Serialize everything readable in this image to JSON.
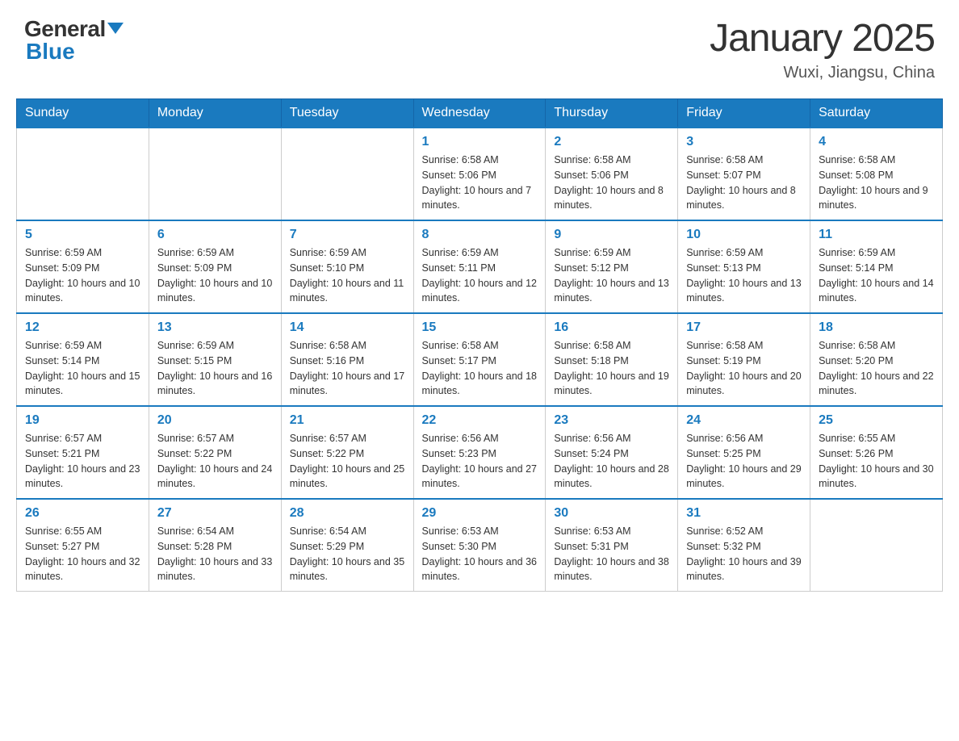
{
  "header": {
    "logo_general": "General",
    "logo_blue": "Blue",
    "month_title": "January 2025",
    "location": "Wuxi, Jiangsu, China"
  },
  "days_of_week": [
    "Sunday",
    "Monday",
    "Tuesday",
    "Wednesday",
    "Thursday",
    "Friday",
    "Saturday"
  ],
  "weeks": [
    [
      {
        "day": "",
        "info": ""
      },
      {
        "day": "",
        "info": ""
      },
      {
        "day": "",
        "info": ""
      },
      {
        "day": "1",
        "info": "Sunrise: 6:58 AM\nSunset: 5:06 PM\nDaylight: 10 hours and 7 minutes."
      },
      {
        "day": "2",
        "info": "Sunrise: 6:58 AM\nSunset: 5:06 PM\nDaylight: 10 hours and 8 minutes."
      },
      {
        "day": "3",
        "info": "Sunrise: 6:58 AM\nSunset: 5:07 PM\nDaylight: 10 hours and 8 minutes."
      },
      {
        "day": "4",
        "info": "Sunrise: 6:58 AM\nSunset: 5:08 PM\nDaylight: 10 hours and 9 minutes."
      }
    ],
    [
      {
        "day": "5",
        "info": "Sunrise: 6:59 AM\nSunset: 5:09 PM\nDaylight: 10 hours and 10 minutes."
      },
      {
        "day": "6",
        "info": "Sunrise: 6:59 AM\nSunset: 5:09 PM\nDaylight: 10 hours and 10 minutes."
      },
      {
        "day": "7",
        "info": "Sunrise: 6:59 AM\nSunset: 5:10 PM\nDaylight: 10 hours and 11 minutes."
      },
      {
        "day": "8",
        "info": "Sunrise: 6:59 AM\nSunset: 5:11 PM\nDaylight: 10 hours and 12 minutes."
      },
      {
        "day": "9",
        "info": "Sunrise: 6:59 AM\nSunset: 5:12 PM\nDaylight: 10 hours and 13 minutes."
      },
      {
        "day": "10",
        "info": "Sunrise: 6:59 AM\nSunset: 5:13 PM\nDaylight: 10 hours and 13 minutes."
      },
      {
        "day": "11",
        "info": "Sunrise: 6:59 AM\nSunset: 5:14 PM\nDaylight: 10 hours and 14 minutes."
      }
    ],
    [
      {
        "day": "12",
        "info": "Sunrise: 6:59 AM\nSunset: 5:14 PM\nDaylight: 10 hours and 15 minutes."
      },
      {
        "day": "13",
        "info": "Sunrise: 6:59 AM\nSunset: 5:15 PM\nDaylight: 10 hours and 16 minutes."
      },
      {
        "day": "14",
        "info": "Sunrise: 6:58 AM\nSunset: 5:16 PM\nDaylight: 10 hours and 17 minutes."
      },
      {
        "day": "15",
        "info": "Sunrise: 6:58 AM\nSunset: 5:17 PM\nDaylight: 10 hours and 18 minutes."
      },
      {
        "day": "16",
        "info": "Sunrise: 6:58 AM\nSunset: 5:18 PM\nDaylight: 10 hours and 19 minutes."
      },
      {
        "day": "17",
        "info": "Sunrise: 6:58 AM\nSunset: 5:19 PM\nDaylight: 10 hours and 20 minutes."
      },
      {
        "day": "18",
        "info": "Sunrise: 6:58 AM\nSunset: 5:20 PM\nDaylight: 10 hours and 22 minutes."
      }
    ],
    [
      {
        "day": "19",
        "info": "Sunrise: 6:57 AM\nSunset: 5:21 PM\nDaylight: 10 hours and 23 minutes."
      },
      {
        "day": "20",
        "info": "Sunrise: 6:57 AM\nSunset: 5:22 PM\nDaylight: 10 hours and 24 minutes."
      },
      {
        "day": "21",
        "info": "Sunrise: 6:57 AM\nSunset: 5:22 PM\nDaylight: 10 hours and 25 minutes."
      },
      {
        "day": "22",
        "info": "Sunrise: 6:56 AM\nSunset: 5:23 PM\nDaylight: 10 hours and 27 minutes."
      },
      {
        "day": "23",
        "info": "Sunrise: 6:56 AM\nSunset: 5:24 PM\nDaylight: 10 hours and 28 minutes."
      },
      {
        "day": "24",
        "info": "Sunrise: 6:56 AM\nSunset: 5:25 PM\nDaylight: 10 hours and 29 minutes."
      },
      {
        "day": "25",
        "info": "Sunrise: 6:55 AM\nSunset: 5:26 PM\nDaylight: 10 hours and 30 minutes."
      }
    ],
    [
      {
        "day": "26",
        "info": "Sunrise: 6:55 AM\nSunset: 5:27 PM\nDaylight: 10 hours and 32 minutes."
      },
      {
        "day": "27",
        "info": "Sunrise: 6:54 AM\nSunset: 5:28 PM\nDaylight: 10 hours and 33 minutes."
      },
      {
        "day": "28",
        "info": "Sunrise: 6:54 AM\nSunset: 5:29 PM\nDaylight: 10 hours and 35 minutes."
      },
      {
        "day": "29",
        "info": "Sunrise: 6:53 AM\nSunset: 5:30 PM\nDaylight: 10 hours and 36 minutes."
      },
      {
        "day": "30",
        "info": "Sunrise: 6:53 AM\nSunset: 5:31 PM\nDaylight: 10 hours and 38 minutes."
      },
      {
        "day": "31",
        "info": "Sunrise: 6:52 AM\nSunset: 5:32 PM\nDaylight: 10 hours and 39 minutes."
      },
      {
        "day": "",
        "info": ""
      }
    ]
  ]
}
